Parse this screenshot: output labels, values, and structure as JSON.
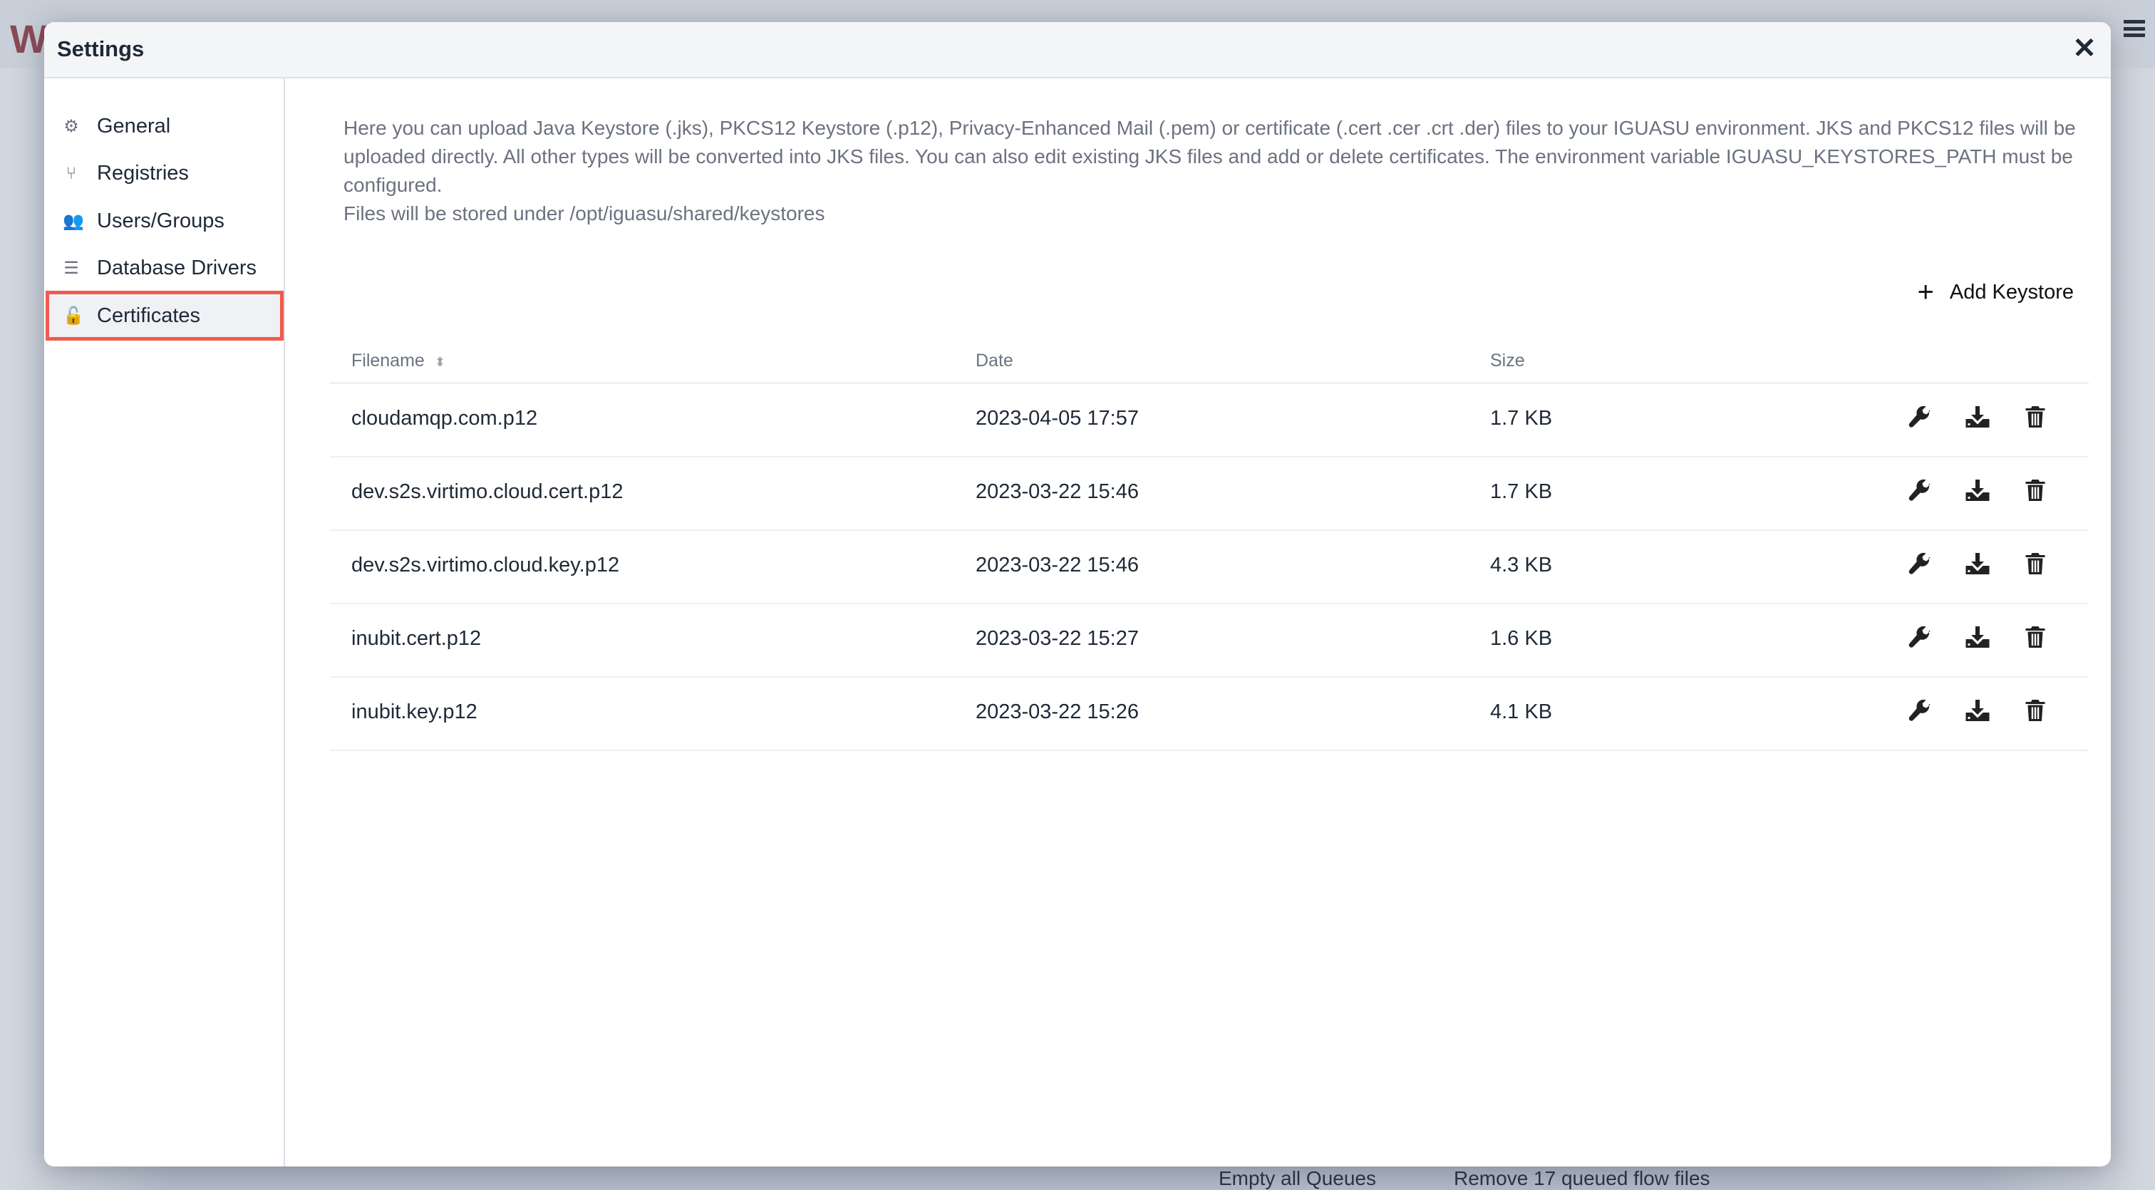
{
  "background": {
    "logo": "VIRTIMO",
    "bottom_items": [
      "Empty all Queues",
      "Remove 17 queued flow files"
    ]
  },
  "modal": {
    "title": "Settings",
    "close_icon": "close-icon"
  },
  "sidebar": {
    "items": [
      {
        "label": "General",
        "icon": "gear-icon"
      },
      {
        "label": "Registries",
        "icon": "code-branch-icon"
      },
      {
        "label": "Users/Groups",
        "icon": "users-icon"
      },
      {
        "label": "Database Drivers",
        "icon": "database-icon"
      },
      {
        "label": "Certificates",
        "icon": "unlock-icon",
        "active": true
      }
    ]
  },
  "content": {
    "description": "Here you can upload Java Keystore (.jks), PKCS12 Keystore (.p12), Privacy-Enhanced Mail (.pem) or certificate (.cert .cer .crt .der) files to your IGUASU environment. JKS and PKCS12 files will be uploaded directly. All other types will be converted into JKS files. You can also edit existing JKS files and add or delete certificates. The environment variable IGUASU_KEYSTORES_PATH must be configured.",
    "storage_note": "Files will be stored under /opt/iguasu/shared/keystores",
    "add_button": "Add Keystore",
    "columns": [
      "Filename",
      "Date",
      "Size"
    ],
    "rows": [
      {
        "filename": "cloudamqp.com.p12",
        "date": "2023-04-05 17:57",
        "size": "1.7 KB"
      },
      {
        "filename": "dev.s2s.virtimo.cloud.cert.p12",
        "date": "2023-03-22 15:46",
        "size": "1.7 KB"
      },
      {
        "filename": "dev.s2s.virtimo.cloud.key.p12",
        "date": "2023-03-22 15:46",
        "size": "4.3 KB"
      },
      {
        "filename": "inubit.cert.p12",
        "date": "2023-03-22 15:27",
        "size": "1.6 KB"
      },
      {
        "filename": "inubit.key.p12",
        "date": "2023-03-22 15:26",
        "size": "4.1 KB"
      }
    ],
    "row_actions": [
      "wrench-icon",
      "download-icon",
      "trash-icon"
    ]
  }
}
